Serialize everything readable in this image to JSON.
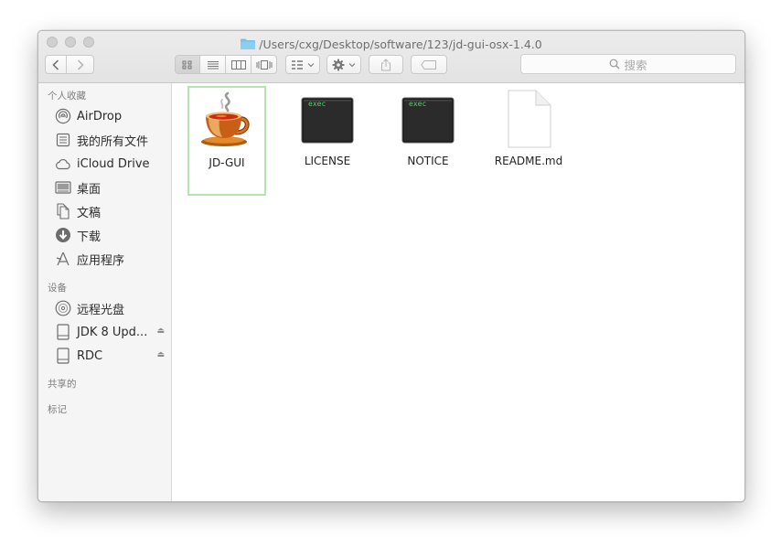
{
  "window": {
    "title": "/Users/cxg/Desktop/software/123/jd-gui-osx-1.4.0"
  },
  "toolbar": {
    "search_placeholder": "搜索"
  },
  "sidebar": {
    "favorites_title": "个人收藏",
    "favorites": [
      {
        "label": "AirDrop",
        "icon": "airdrop-icon"
      },
      {
        "label": "我的所有文件",
        "icon": "all-files-icon"
      },
      {
        "label": "iCloud Drive",
        "icon": "cloud-icon"
      },
      {
        "label": "桌面",
        "icon": "desktop-icon"
      },
      {
        "label": "文稿",
        "icon": "documents-icon"
      },
      {
        "label": "下载",
        "icon": "download-icon"
      },
      {
        "label": "应用程序",
        "icon": "applications-icon"
      }
    ],
    "devices_title": "设备",
    "devices": [
      {
        "label": "远程光盘",
        "icon": "disc-icon"
      },
      {
        "label": "JDK 8 Upd...",
        "icon": "drive-icon",
        "eject": "⏏"
      },
      {
        "label": "RDC",
        "icon": "drive-icon",
        "eject": "⏏"
      }
    ],
    "shared_title": "共享的",
    "tags_title": "标记"
  },
  "files": [
    {
      "name": "JD-GUI",
      "icon": "java-coffee-icon",
      "selected": true
    },
    {
      "name": "LICENSE",
      "icon": "exec-icon",
      "badge": "exec"
    },
    {
      "name": "NOTICE",
      "icon": "exec-icon",
      "badge": "exec"
    },
    {
      "name": "README.md",
      "icon": "document-icon"
    }
  ],
  "colors": {
    "selection_border": "#b7e3ae",
    "folder_blue": "#79c0ea",
    "exec_green": "#3ddc58"
  }
}
